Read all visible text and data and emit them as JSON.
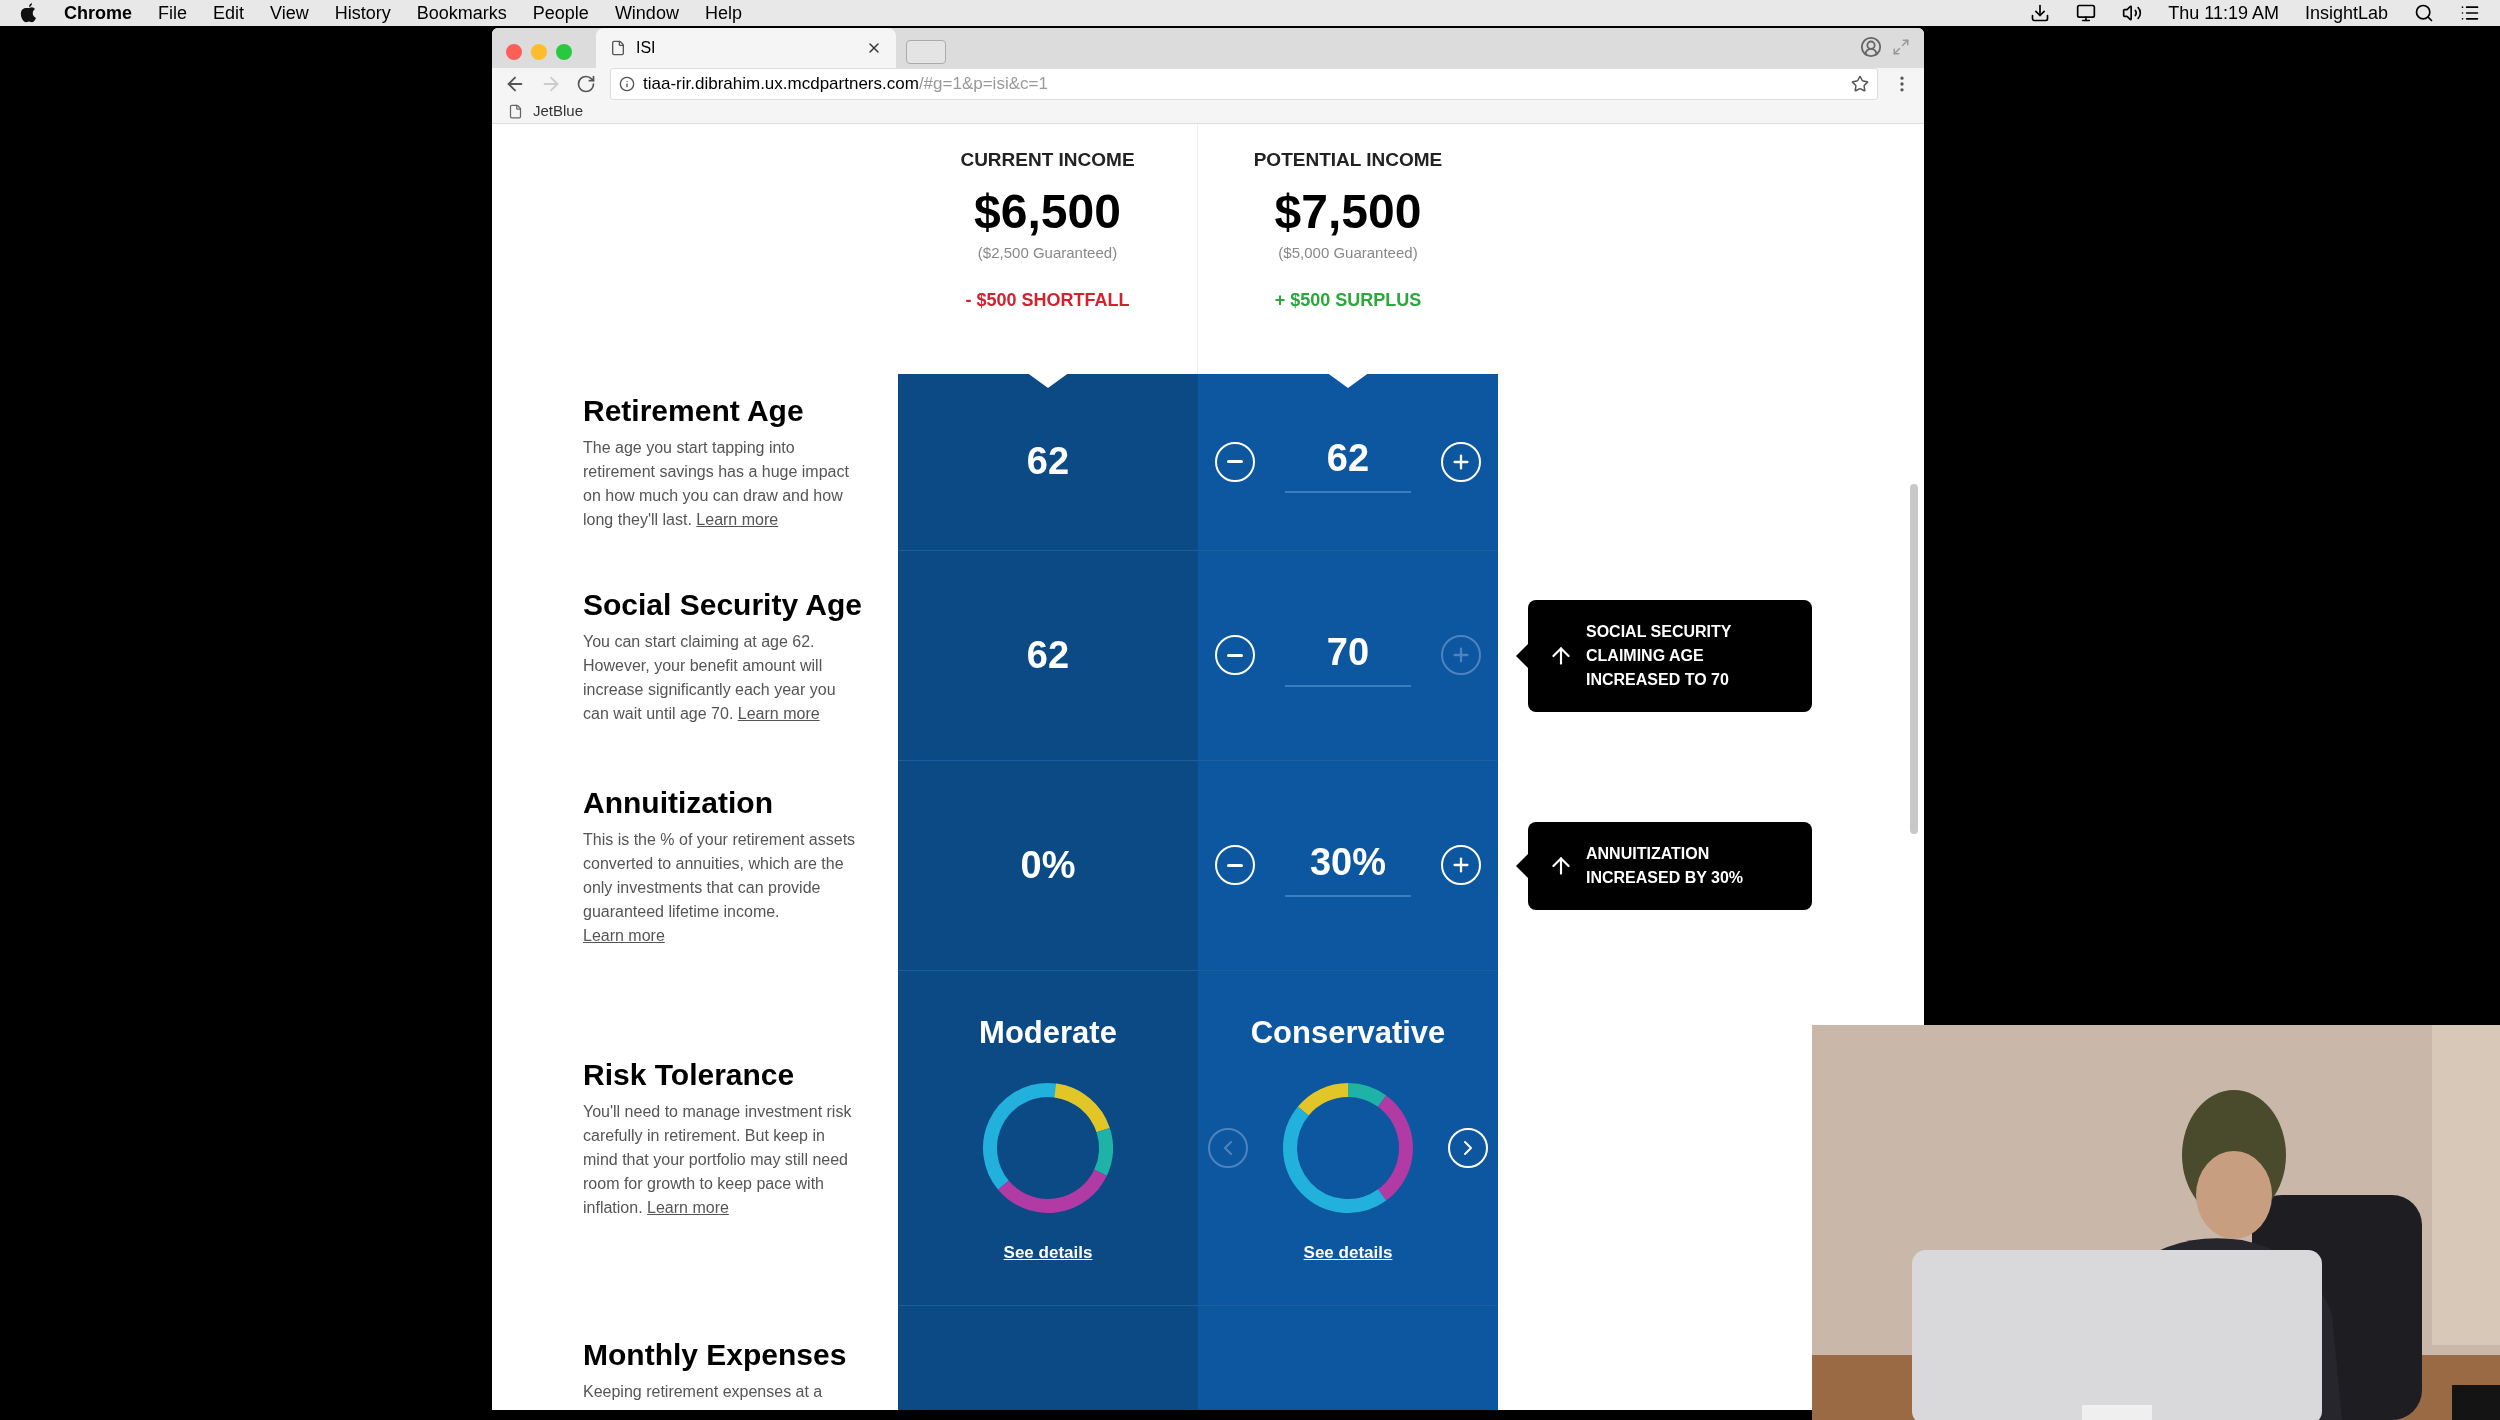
{
  "menu_bar": {
    "app": "Chrome",
    "menus": [
      "File",
      "Edit",
      "View",
      "History",
      "Bookmarks",
      "People",
      "Window",
      "Help"
    ],
    "clock": "Thu 11:19 AM",
    "user": "InsightLab"
  },
  "browser": {
    "tab": {
      "title": "ISI"
    },
    "url": {
      "host": "tiaa-rir.dibrahim.ux.mcdpartners.com",
      "rest": "/#g=1&p=isi&c=1"
    },
    "bookmarks": [
      "JetBlue"
    ]
  },
  "columns": [
    {
      "heading": "CURRENT INCOME",
      "amount": "$6,500",
      "guaranteed": "($2,500 Guaranteed)",
      "delta": "- $500 SHORTFALL",
      "color": "#d3212e"
    },
    {
      "heading": "POTENTIAL INCOME",
      "amount": "$7,500",
      "guaranteed": "($5,000 Guaranteed)",
      "delta": "+ $500 SURPLUS",
      "color": "#2aa83a"
    }
  ],
  "rows": [
    {
      "kind": "number",
      "title": "Retirement Age",
      "description": "The age you start tapping into retirement savings has a huge impact on how much you can draw and how long they'll last.",
      "link": "Learn more",
      "current": {
        "value": "62"
      },
      "potential": {
        "value": "62",
        "minus_disabled": false,
        "plus_disabled": false
      }
    },
    {
      "kind": "number",
      "title": "Social Security Age",
      "description": "You can start claiming at age 62. However, your benefit amount will increase significantly each year you can wait until age 70.",
      "link": "Learn more",
      "current": {
        "value": "62"
      },
      "potential": {
        "value": "70",
        "minus_disabled": false,
        "plus_disabled": true
      },
      "note": "SOCIAL SECURITY CLAIMING AGE INCREASED TO 70"
    },
    {
      "kind": "number",
      "title": "Annuitization",
      "description": "This is the % of your retirement assets converted to annuities, which are the only investments that can provide guaranteed lifetime income.",
      "link": "Learn more",
      "current": {
        "value": "0%"
      },
      "potential": {
        "value": "30%",
        "minus_disabled": false,
        "plus_disabled": false
      },
      "note": "ANNUITIZATION INCREASED BY 30%"
    },
    {
      "kind": "portfolio",
      "title": "Risk Tolerance",
      "description": "You'll need to manage investment risk carefully in retirement. But keep in mind that your portfolio may still need room for growth to keep pace with inflation.",
      "link": "Learn more",
      "current": {
        "value": "Moderate",
        "link": "See details"
      },
      "potential": {
        "value": "Conservative",
        "link": "See details",
        "prev_disabled": true,
        "next_disabled": false
      }
    },
    {
      "kind": "cut",
      "title": "Monthly Expenses",
      "description": "Keeping retirement expenses at a"
    }
  ]
}
